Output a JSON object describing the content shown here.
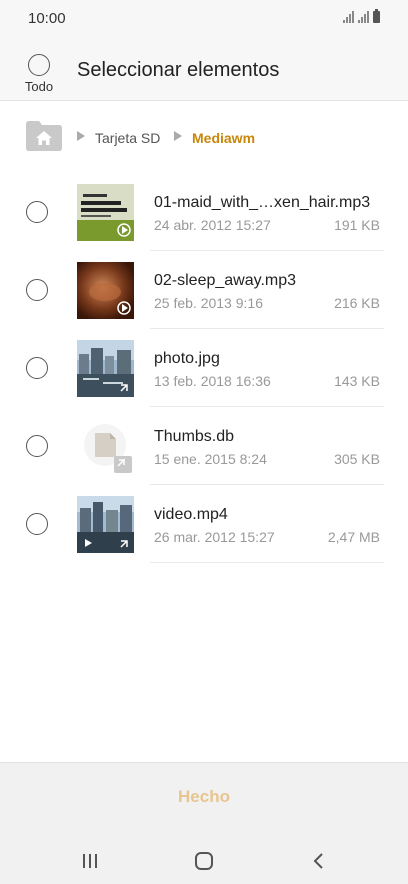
{
  "status_bar": {
    "time": "10:00"
  },
  "header": {
    "select_all_label": "Todo",
    "title": "Seleccionar elementos"
  },
  "breadcrumb": {
    "items": [
      "Tarjeta SD",
      "Mediawm"
    ]
  },
  "files": [
    {
      "name": "01-maid_with_…xen_hair.mp3",
      "date": "24 abr. 2012 15:27",
      "size": "191 KB",
      "thumb": "music-album-icon"
    },
    {
      "name": "02-sleep_away.mp3",
      "date": "25 feb. 2013 9:16",
      "size": "216 KB",
      "thumb": "music-album-icon"
    },
    {
      "name": "photo.jpg",
      "date": "13 feb. 2018 16:36",
      "size": "143 KB",
      "thumb": "photo-icon"
    },
    {
      "name": "Thumbs.db",
      "date": "15 ene. 2015 8:24",
      "size": "305 KB",
      "thumb": "file-icon"
    },
    {
      "name": "video.mp4",
      "date": "26 mar. 2012 15:27",
      "size": "2,47 MB",
      "thumb": "video-icon"
    }
  ],
  "footer": {
    "done_label": "Hecho"
  },
  "colors": {
    "accent": "#c8860a",
    "done_disabled": "#e8c590"
  }
}
